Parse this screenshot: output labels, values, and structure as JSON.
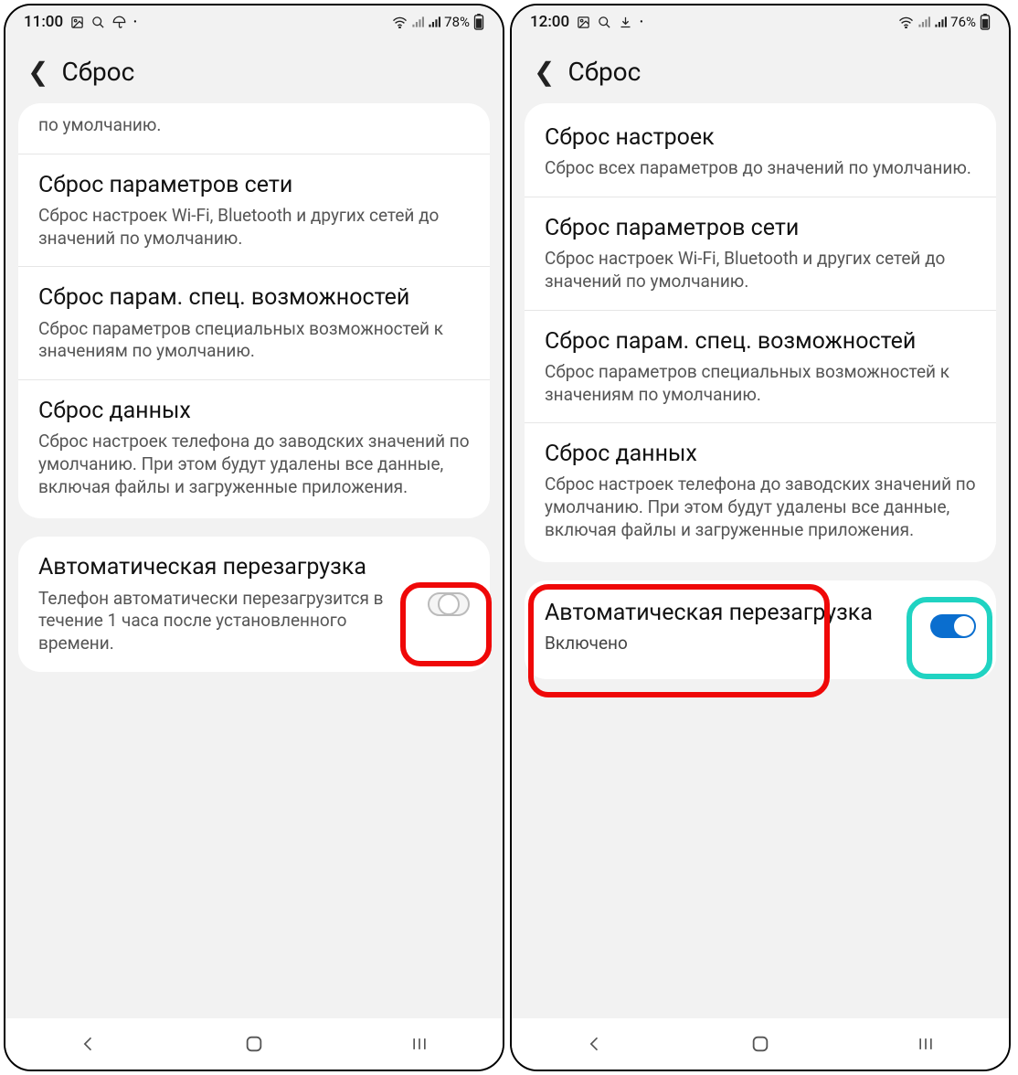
{
  "left": {
    "statusbar": {
      "time": "11:00",
      "battery": "78%"
    },
    "header": {
      "title": "Сброс"
    },
    "partial_item": {
      "desc": "по умолчанию."
    },
    "items": [
      {
        "title": "Сброс параметров сети",
        "desc": "Сброс настроек Wi-Fi, Bluetooth и других сетей до значений по умолчанию."
      },
      {
        "title": "Сброс парам. спец. возможностей",
        "desc": "Сброс параметров специальных возможностей к значениям по умолчанию."
      },
      {
        "title": "Сброс данных",
        "desc": "Сброс настроек телефона до заводских значений по умолчанию. При этом будут удалены все данные, включая файлы и загруженные приложения."
      }
    ],
    "auto_restart": {
      "title": "Автоматическая перезагрузка",
      "desc": "Телефон автоматически перезагрузится в течение 1 часа после установленного времени.",
      "on": false
    }
  },
  "right": {
    "statusbar": {
      "time": "12:00",
      "battery": "76%"
    },
    "header": {
      "title": "Сброс"
    },
    "items": [
      {
        "title": "Сброс настроек",
        "desc": "Сброс всех параметров до значений по умолчанию."
      },
      {
        "title": "Сброс параметров сети",
        "desc": "Сброс настроек Wi-Fi, Bluetooth и других сетей до значений по умолчанию."
      },
      {
        "title": "Сброс парам. спец. возможностей",
        "desc": "Сброс параметров специальных возможностей к значениям по умолчанию."
      },
      {
        "title": "Сброс данных",
        "desc": "Сброс настроек телефона до заводских значений по умолчанию. При этом будут удалены все данные, включая файлы и загруженные приложения."
      }
    ],
    "auto_restart": {
      "title": "Автоматическая перезагрузка",
      "status": "Включено",
      "on": true
    }
  }
}
